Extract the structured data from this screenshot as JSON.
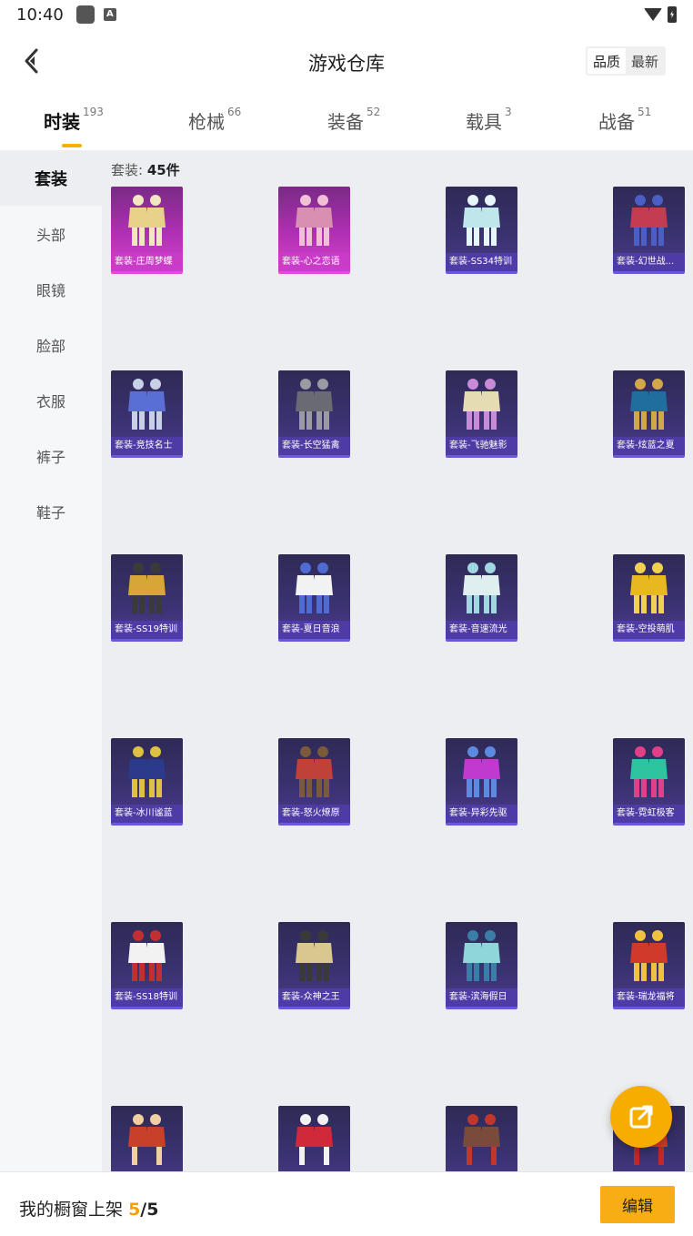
{
  "status": {
    "time": "10:40",
    "a_badge": "A"
  },
  "header": {
    "title": "游戏仓库",
    "sort_quality": "品质",
    "sort_newest": "最新"
  },
  "tabs": [
    {
      "label": "时装",
      "count": "193"
    },
    {
      "label": "枪械",
      "count": "66"
    },
    {
      "label": "装备",
      "count": "52"
    },
    {
      "label": "载具",
      "count": "3"
    },
    {
      "label": "战备",
      "count": "51"
    }
  ],
  "sidenav": [
    "套装",
    "头部",
    "眼镜",
    "脸部",
    "衣服",
    "裤子",
    "鞋子"
  ],
  "grid": {
    "count_prefix": "套装:",
    "count_value": "45件",
    "items": [
      "套装-庄周梦蝶",
      "套装-心之恋语",
      "套装-SS34特训",
      "套装-幻世战...",
      "套装-竞技名士",
      "套装-长空猛禽",
      "套装-飞驰魅影",
      "套装-炫蓝之夏",
      "套装-SS19特训",
      "套装-夏日音浪",
      "套装-音速流光",
      "套装-空投萌肌",
      "套装-冰川谧蓝",
      "套装-怒火燎原",
      "套装-异彩先驱",
      "套装-霓虹极客",
      "套装-SS18特训",
      "套装-众神之王",
      "套装-滨海假日",
      "套装-瑞龙福将"
    ]
  },
  "colors": {
    "accent": "#f7ad00",
    "card_purple": "#3b3272",
    "card_pink": "#b02fb4"
  },
  "bottom": {
    "shelf_label": "我的橱窗上架",
    "shelf_used": "5",
    "shelf_total": "/5",
    "edit_label": "编辑"
  },
  "icons": {
    "back": "chevron-left-icon",
    "fab": "share-external-icon"
  }
}
